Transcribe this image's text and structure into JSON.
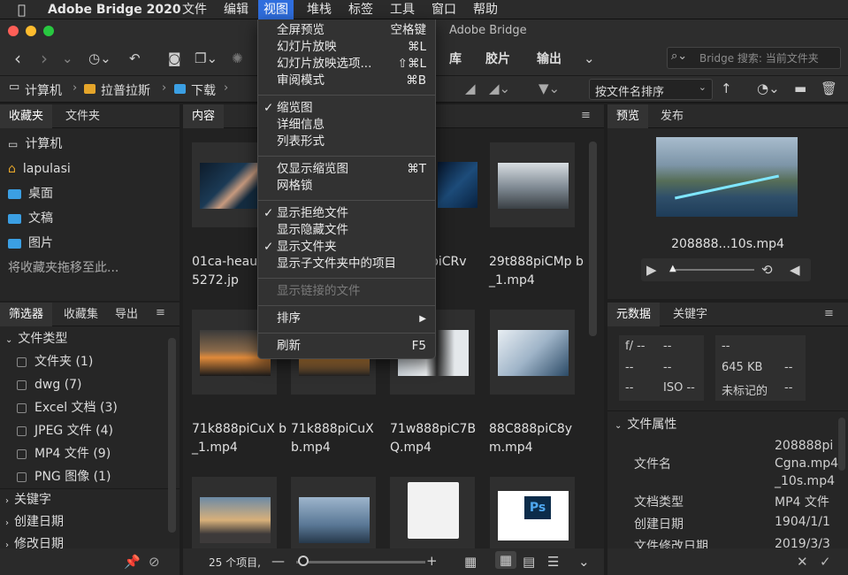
{
  "menubar": {
    "apple": "",
    "app": "Adobe Bridge 2020",
    "items": [
      "文件",
      "编辑",
      "视图",
      "堆栈",
      "标签",
      "工具",
      "窗口",
      "帮助"
    ]
  },
  "window": {
    "title": "Adobe Bridge"
  },
  "toolbar": {
    "lib": "库",
    "film": "胶片",
    "output": "输出",
    "search_placeholder": "Bridge 搜索: 当前文件夹"
  },
  "path": {
    "items": [
      "计算机",
      "拉普拉斯",
      "下载"
    ],
    "sort": "按文件名排序"
  },
  "fav_panel": {
    "tabs": [
      "收藏夹",
      "文件夹"
    ],
    "items": [
      "计算机",
      "lapulasi",
      "桌面",
      "文稿",
      "图片"
    ],
    "hint": "将收藏夹拖移至此..."
  },
  "filter_panel": {
    "tabs": [
      "筛选器",
      "收藏集",
      "导出"
    ],
    "group": "文件类型",
    "items": [
      {
        "label": "文件夹",
        "count": "(1)"
      },
      {
        "label": "dwg",
        "count": "(7)"
      },
      {
        "label": "Excel 文档",
        "count": "(3)"
      },
      {
        "label": "JPEG 文件",
        "count": "(4)"
      },
      {
        "label": "MP4 文件",
        "count": "(9)"
      },
      {
        "label": "PNG 图像",
        "count": "(1)"
      }
    ],
    "groups": [
      "关键字",
      "创建日期",
      "修改日期"
    ]
  },
  "content": {
    "tab": "内容",
    "names": [
      "01ca-heau 8365272.jp",
      "",
      "pOpiCRv .0s.mp4",
      "29t888piCMp b_1.mp4",
      "71k888piCuX b_1.mp4",
      "71k888piCuX b.mp4",
      "71w888piC7B Q.mp4",
      "88C888piC8y m.mp4"
    ],
    "count": "25 个项目,"
  },
  "preview": {
    "tabs": [
      "预览",
      "发布"
    ],
    "filename": "208888...10s.mp4"
  },
  "metadata": {
    "tabs": [
      "元数据",
      "关键字"
    ],
    "cam": [
      "f/ --",
      "--",
      "--",
      "--",
      "--",
      "ISO --"
    ],
    "file": [
      "--",
      "645 KB",
      "--",
      "未标记的",
      "--"
    ],
    "section": "文件属性",
    "rows": [
      {
        "k": "文件名",
        "v": "208888piCgna.mp4_10s.mp4"
      },
      {
        "k": "文档类型",
        "v": "MP4 文件"
      },
      {
        "k": "创建日期",
        "v": "1904/1/1"
      },
      {
        "k": "文件修改日期",
        "v": "2019/3/3"
      }
    ]
  },
  "view_menu": {
    "items": [
      {
        "label": "全屏预览",
        "sc": "空格键"
      },
      {
        "label": "幻灯片放映",
        "sc": "⌘L"
      },
      {
        "label": "幻灯片放映选项...",
        "sc": "⇧⌘L"
      },
      {
        "label": "审阅模式",
        "sc": "⌘B"
      },
      {
        "label": "缩览图",
        "sc": "",
        "check": "✓"
      },
      {
        "label": "详细信息",
        "sc": ""
      },
      {
        "label": "列表形式",
        "sc": ""
      },
      {
        "label": "仅显示缩览图",
        "sc": "⌘T"
      },
      {
        "label": "网格锁",
        "sc": ""
      },
      {
        "label": "显示拒绝文件",
        "sc": "",
        "check": "✓"
      },
      {
        "label": "显示隐藏文件",
        "sc": ""
      },
      {
        "label": "显示文件夹",
        "sc": "",
        "check": "✓"
      },
      {
        "label": "显示子文件夹中的项目",
        "sc": ""
      },
      {
        "label": "显示链接的文件",
        "sc": ""
      },
      {
        "label": "排序",
        "sc": "▶"
      },
      {
        "label": "刷新",
        "sc": "F5"
      }
    ]
  },
  "colors": {
    "accent": "#2f6ede",
    "folder": "#3b9fe3"
  }
}
